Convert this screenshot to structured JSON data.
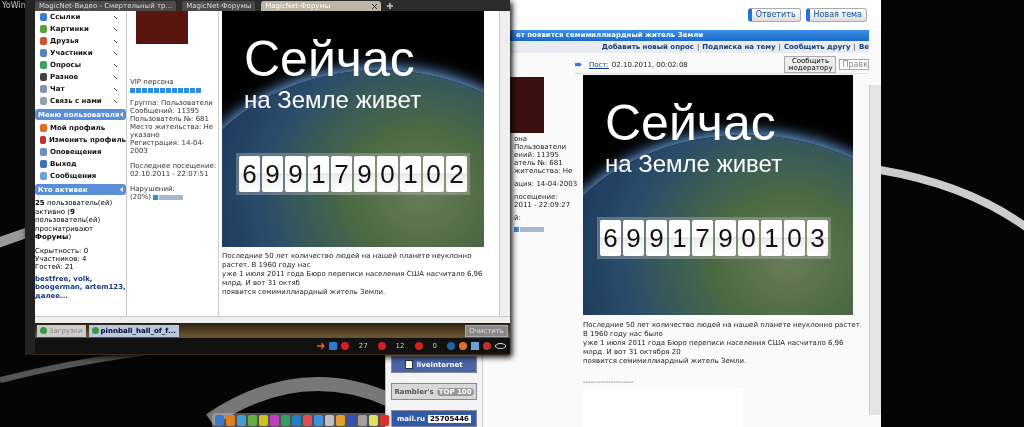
{
  "desktop": {
    "corner_text": "YoWin"
  },
  "back_window": {
    "buttons": [
      "Ответить",
      "Новая тема"
    ],
    "topic_title": "ет появится семимиллиардный житель Земли",
    "topic_links": [
      "Добавить новый опрос",
      "Подписка на тему",
      "Сообщить другу",
      "Ве"
    ],
    "link_separator": "|",
    "profile_groups": [
      [
        "она",
        "Пользователи",
        "ений: 11395",
        "атель №: 681",
        "жительства: Не"
      ],
      [
        "ация: 14-04-2003"
      ],
      [
        "посещение:",
        "2011 - 22:09:27"
      ],
      [
        "й:"
      ]
    ],
    "violations": {
      "level": 0.2
    },
    "post_label": "Пост:",
    "post_date": "02.10.2011, 00:02:08",
    "report_button": "Сообщить модератору",
    "edit_button": "Правк",
    "picture": {
      "heading": "Сейчас",
      "subheading": "на Земле живет",
      "digits": [
        "6",
        "9",
        "9",
        "1",
        "7",
        "9",
        "0",
        "1",
        "0",
        "3"
      ]
    },
    "paragraph_lines": [
      "Последние 50 лет количество людей на нашей планете неуклонно растет. В 1960 году нас было",
      "уже 1 июля 2011 года Бюро переписи населения США насчитало 6,96 млрд. И вот 31 октября 20",
      "появится семимиллиардный житель Земли."
    ],
    "separator": "--------------------",
    "counters": [
      {
        "kind": "liveinternet",
        "label": "liveinternet"
      },
      {
        "kind": "rambler",
        "label": "Rambler's",
        "badge": "TOP 100"
      },
      {
        "kind": "mail",
        "label": "mail.ru",
        "number": "25705446"
      }
    ]
  },
  "front_window": {
    "tabs": [
      {
        "label": "MagicNet-Видео - Смертельный тр...",
        "selected": false
      },
      {
        "label": "MagicNet-Форумы",
        "selected": false
      },
      {
        "label": "MagicNet-Форумы",
        "selected": true
      }
    ],
    "menu": [
      {
        "label": "Ссылки"
      },
      {
        "label": "Картинки"
      },
      {
        "label": "Друзья"
      },
      {
        "label": "Участники"
      },
      {
        "label": "Опросы"
      },
      {
        "label": "Разное"
      },
      {
        "label": "Чат"
      },
      {
        "label": "Связь с нами"
      }
    ],
    "user_menu": {
      "title": "Меню пользователя",
      "items": [
        "Мой профиль",
        "Изменить профиль",
        "Оповещения",
        "Выход",
        "Сообщения"
      ]
    },
    "active": {
      "title": "Кто активен",
      "summary": "**25** пользователь(ей) активно (**9** пользователь(ей) просматривают **Форумы**)",
      "stats": [
        "Скрытность: 0",
        "Участников: 4",
        "Гостей: 21"
      ],
      "users": "bestfree, volk, boogerman, artem123, далее..."
    },
    "profile": {
      "rank": "VIP персона",
      "rank_bar": {
        "level": 1
      },
      "lines": [
        "Группа: Пользователи",
        "Сообщений: 11395",
        "Пользователь №: 681",
        "Место жительства: Не указано",
        "Регистрация: 14-04-2003"
      ],
      "last_visit_label": "Последнее посещение:",
      "last_visit": "02.10.2011 - 22:07:51",
      "violations_label": "Нарушений:",
      "violations_pct": "(20%)",
      "violations": {
        "level": 0.2
      }
    },
    "picture": {
      "heading": "Сейчас",
      "subheading": "на Земле живет",
      "digits": [
        "6",
        "9",
        "9",
        "1",
        "7",
        "9",
        "0",
        "1",
        "0",
        "2"
      ]
    },
    "paragraph_lines": [
      "Последние 50 лет количество людей на нашей планете неуклонно растет. В 1960 году нас",
      "уже 1 июля 2011 года Бюро переписи населения США насчитало 6,96 млрд. И вот 31 октяб",
      "появится семимиллиардный житель Земли."
    ],
    "panel_tabs": [
      {
        "label": "Загрузки",
        "selected": false
      },
      {
        "label": "pinnball_hall_of_f...",
        "selected": true
      }
    ],
    "clear_button": "Очистить",
    "tray_counts": [
      "27",
      "12",
      "0"
    ]
  }
}
